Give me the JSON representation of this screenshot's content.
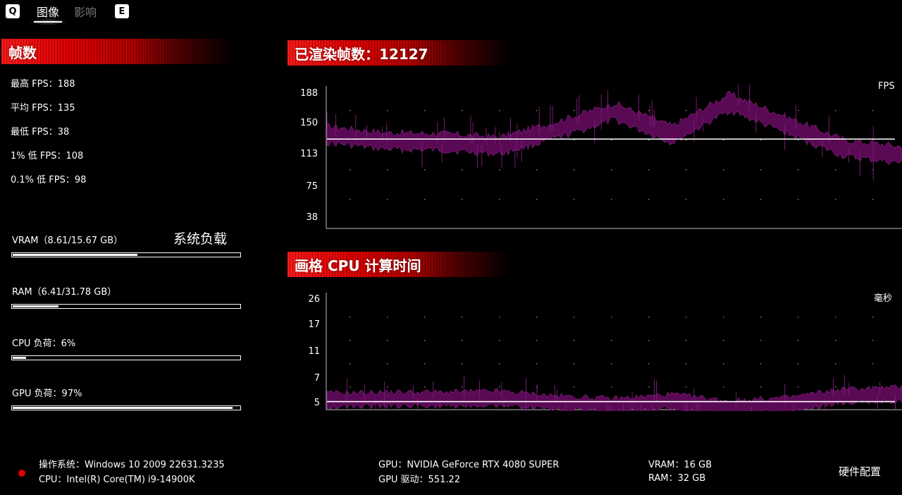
{
  "tabs": {
    "key_left": "Q",
    "key_right": "E",
    "items": [
      {
        "label": "图像",
        "active": true
      },
      {
        "label": "影响",
        "active": false
      }
    ]
  },
  "framerate": {
    "title": "帧数",
    "max": "最高 FPS：188",
    "avg": "平均 FPS：135",
    "min": "最低 FPS：38",
    "low1": "1% 低 FPS：108",
    "low01": "0.1% 低 FPS：98"
  },
  "system_load": {
    "title": "系统负载",
    "items": [
      {
        "label": "VRAM（8.61/15.67 GB）",
        "fraction": 0.549
      },
      {
        "label": "RAM（6.41/31.78 GB）",
        "fraction": 0.202
      },
      {
        "label": "CPU 负荷：6%",
        "fraction": 0.06
      },
      {
        "label": "GPU 负荷：97%",
        "fraction": 0.97
      }
    ]
  },
  "fps_chart": {
    "title": "已渲染帧数：12127",
    "unit": "FPS",
    "yticks": [
      "188",
      "150",
      "113",
      "75",
      "38"
    ]
  },
  "cpu_chart": {
    "title": "画格 CPU 计算时间",
    "unit": "毫秒",
    "yticks": [
      "26",
      "17",
      "11",
      "7",
      "5"
    ]
  },
  "chart_data": [
    {
      "type": "area",
      "title": "已渲染帧数：12127",
      "ylabel": "FPS",
      "ylim": [
        38,
        188
      ],
      "yticks": [
        188,
        150,
        113,
        75,
        38
      ],
      "reference_line": 135,
      "x": [
        0,
        10,
        20,
        30,
        40,
        50,
        60,
        70,
        80,
        90,
        100
      ],
      "series": [
        {
          "values": [
            140,
            133,
            132,
            128,
            145,
            165,
            140,
            175,
            150,
            125,
            118
          ]
        }
      ]
    },
    {
      "type": "area",
      "title": "画格 CPU 计算时间",
      "ylabel": "毫秒",
      "ylim": [
        5,
        26
      ],
      "yticks": [
        26,
        17,
        11,
        7,
        5
      ],
      "reference_line": 6.5,
      "x": [
        0,
        10,
        20,
        30,
        40,
        50,
        60,
        70,
        80,
        90,
        100
      ],
      "series": [
        {
          "values": [
            6.8,
            7.0,
            7.0,
            7.2,
            6.3,
            5.8,
            6.6,
            5.4,
            6.0,
            7.6,
            7.9
          ]
        }
      ]
    }
  ],
  "hardware": {
    "os": "操作系统：Windows 10 2009 22631.3235",
    "cpu": "CPU：Intel(R) Core(TM) i9-14900K",
    "gpu": "GPU：NVIDIA GeForce RTX 4080 SUPER",
    "gpu_driver": "GPU 驱动：551.22",
    "vram": "VRAM：16 GB",
    "ram": "RAM：32 GB",
    "title": "硬件配置"
  },
  "colors": {
    "accent_red": "#e00000",
    "plot_fill": "#5a0a55",
    "plot_line": "#7a1a75"
  }
}
